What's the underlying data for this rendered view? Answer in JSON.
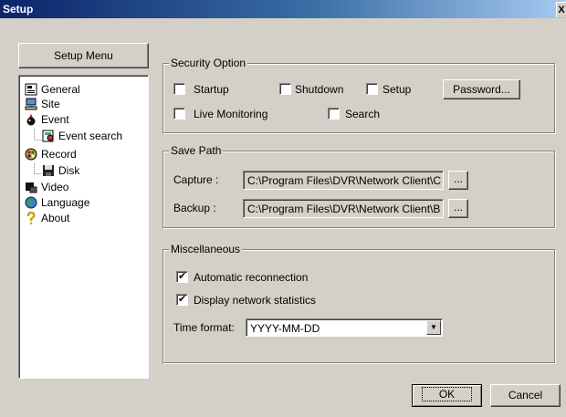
{
  "window": {
    "title": "Setup",
    "close_label": "X"
  },
  "sidebar": {
    "menu_button": "Setup Menu",
    "items": [
      {
        "label": "General",
        "icon": "general-icon"
      },
      {
        "label": "Site",
        "icon": "site-icon"
      },
      {
        "label": "Event",
        "icon": "event-icon"
      },
      {
        "label": "Event search",
        "icon": "event-search-icon"
      },
      {
        "label": "Record",
        "icon": "record-icon"
      },
      {
        "label": "Disk",
        "icon": "disk-icon"
      },
      {
        "label": "Video",
        "icon": "video-icon"
      },
      {
        "label": "Language",
        "icon": "language-icon"
      },
      {
        "label": "About",
        "icon": "about-icon"
      }
    ]
  },
  "security": {
    "title": "Security Option",
    "startup": {
      "label": "Startup",
      "checked": false
    },
    "shutdown": {
      "label": "Shutdown",
      "checked": false
    },
    "setup": {
      "label": "Setup",
      "checked": false
    },
    "live": {
      "label": "Live Monitoring",
      "checked": false
    },
    "search": {
      "label": "Search",
      "checked": false
    },
    "password_button": "Password..."
  },
  "save_path": {
    "title": "Save Path",
    "capture_label": "Capture :",
    "capture_value": "C:\\Program Files\\DVR\\Network Client\\C",
    "backup_label": "Backup :",
    "backup_value": "C:\\Program Files\\DVR\\Network Client\\B",
    "browse_label": "..."
  },
  "misc": {
    "title": "Miscellaneous",
    "auto_reconnect": {
      "label": "Automatic reconnection",
      "checked": true
    },
    "net_stats": {
      "label": "Display network statistics",
      "checked": true
    },
    "time_format_label": "Time format:",
    "time_format_value": "YYYY-MM-DD"
  },
  "footer": {
    "ok": "OK",
    "cancel": "Cancel"
  }
}
